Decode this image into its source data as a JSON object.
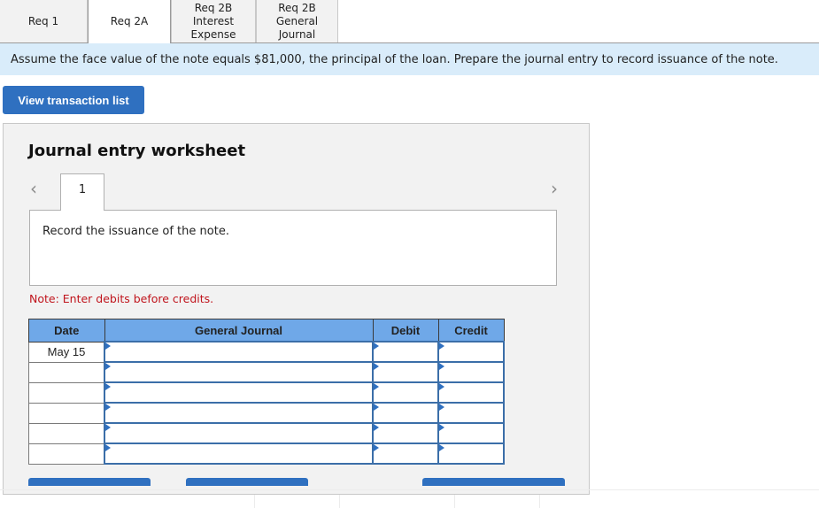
{
  "tabs": [
    {
      "label": "Req 1",
      "active": false
    },
    {
      "label": "Req 2A",
      "active": true
    },
    {
      "label": "Req 2B\nInterest\nExpense",
      "active": false
    },
    {
      "label": "Req 2B\nGeneral\nJournal",
      "active": false
    }
  ],
  "instruction": "Assume the face value of the note equals $81,000, the principal of the loan. Prepare the journal entry to record issuance of the note.",
  "view_transaction_list_label": "View transaction list",
  "worksheet": {
    "title": "Journal entry worksheet",
    "prev_icon": "chevron-left-icon",
    "next_icon": "chevron-right-icon",
    "entry_tab_label": "1",
    "description": "Record the issuance of the note.",
    "note": "Note: Enter debits before credits.",
    "note_color": "#c0141c",
    "table": {
      "headers": [
        "Date",
        "General Journal",
        "Debit",
        "Credit"
      ],
      "header_color": "#6fa8e8",
      "rows": [
        {
          "date": "May 15",
          "account": "",
          "debit": "",
          "credit": ""
        },
        {
          "date": "",
          "account": "",
          "debit": "",
          "credit": ""
        },
        {
          "date": "",
          "account": "",
          "debit": "",
          "credit": ""
        },
        {
          "date": "",
          "account": "",
          "debit": "",
          "credit": ""
        },
        {
          "date": "",
          "account": "",
          "debit": "",
          "credit": ""
        },
        {
          "date": "",
          "account": "",
          "debit": "",
          "credit": ""
        }
      ]
    }
  },
  "accent_color": "#2f70c0"
}
